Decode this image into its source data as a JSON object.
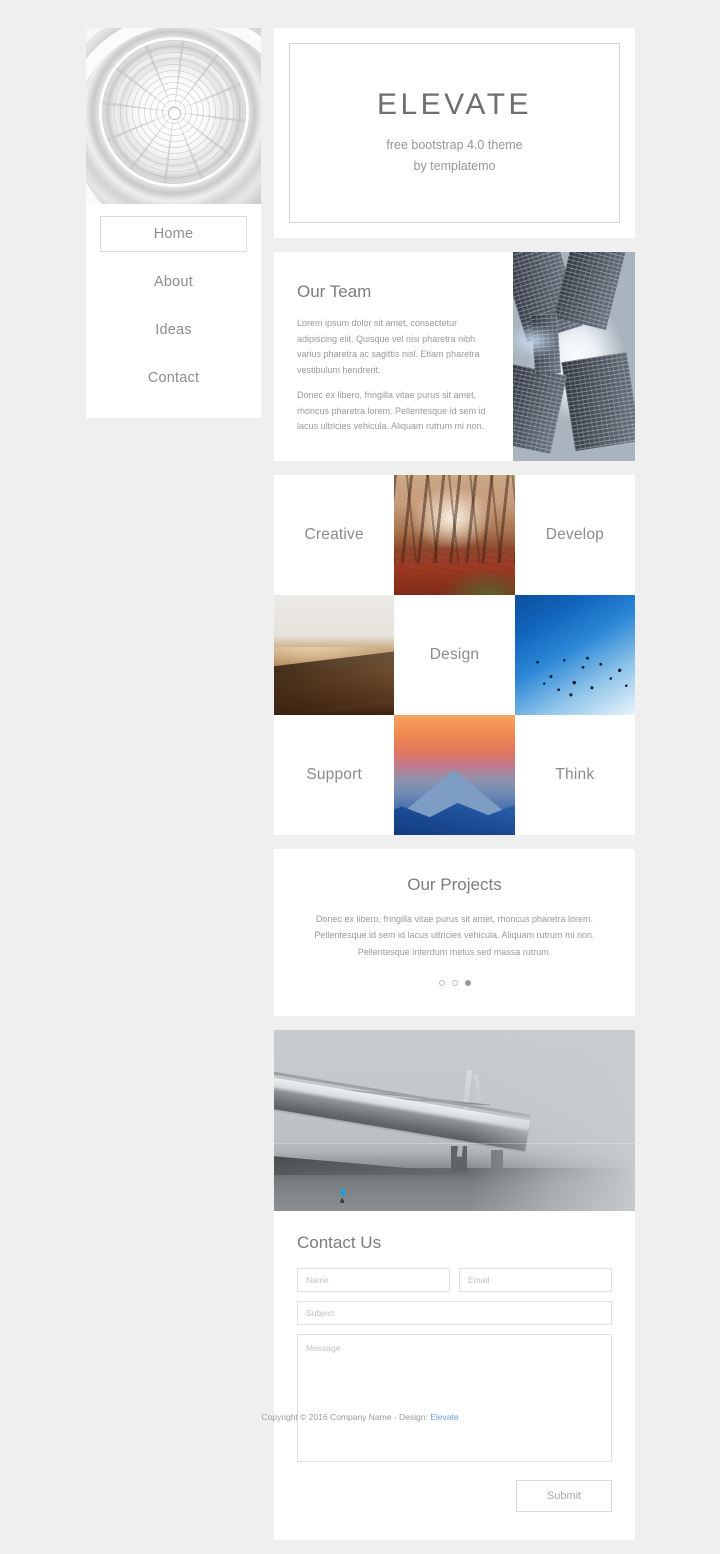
{
  "sidebar": {
    "photo_alt": "guggenheim-rotunda-ceiling",
    "nav": [
      {
        "label": "Home",
        "active": true
      },
      {
        "label": "About",
        "active": false
      },
      {
        "label": "Ideas",
        "active": false
      },
      {
        "label": "Contact",
        "active": false
      }
    ]
  },
  "hero": {
    "title": "ELEVATE",
    "subtitle_line1": "free bootstrap 4.0 theme",
    "subtitle_line2": "by templatemo"
  },
  "team": {
    "title": "Our Team",
    "paragraph1": "Lorem ipsum dolor sit amet, consectetur adipiscing elit. Quisque vel nisi pharetra nibh varius pharetra ac sagittis nisl. Etiam pharetra vestibulum hendrerit.",
    "paragraph2": "Donec ex libero, fringilla vitae purus sit amet, rhoncus pharetra lorem. Pellentesque id sem id lacus ultricies vehicula. Aliquam rutrum mi non.",
    "photo_alt": "skyscrapers-looking-up"
  },
  "grid": {
    "cells": [
      {
        "label": "Creative",
        "kind": "text"
      },
      {
        "label": "",
        "kind": "image",
        "photo_alt": "autumn-forest-path"
      },
      {
        "label": "Develop",
        "kind": "text"
      },
      {
        "label": "",
        "kind": "image",
        "photo_alt": "desert-dunes"
      },
      {
        "label": "Design",
        "kind": "text"
      },
      {
        "label": "",
        "kind": "image",
        "photo_alt": "birds-flying-blue-sky"
      },
      {
        "label": "Support",
        "kind": "text"
      },
      {
        "label": "",
        "kind": "image",
        "photo_alt": "mountain-sunset"
      },
      {
        "label": "Think",
        "kind": "text"
      }
    ]
  },
  "projects": {
    "title": "Our Projects",
    "paragraph": "Donec ex libero, fringilla vitae purus sit amet, rhoncus pharetra lorem. Pellentesque id sem id lacus ultricies vehicula. Aliquam rutrum mi non. Pellentesque interdum metus sed massa rutrum.",
    "dots": [
      {
        "active": false
      },
      {
        "active": false
      },
      {
        "active": true
      }
    ]
  },
  "banner": {
    "photo_alt": "foggy-cable-stayed-bridge"
  },
  "contact": {
    "title": "Contact Us",
    "name_placeholder": "Name",
    "name_value": "",
    "email_placeholder": "Email",
    "email_value": "",
    "subject_placeholder": "Subject",
    "subject_value": "",
    "message_placeholder": "Message",
    "message_value": "",
    "submit_label": "Submit"
  },
  "footer": {
    "text": "Copyright © 2016 Company Name - Design: ",
    "link_label": "Elevate"
  },
  "colors": {
    "page_background": "#f0efef",
    "card_background": "#ffffff",
    "text_muted": "#9a9a9a",
    "heading": "#7c7c7c",
    "border": "#dcdcdc",
    "link": "#6f9fd8",
    "active_dot": "#9a9a9a"
  }
}
